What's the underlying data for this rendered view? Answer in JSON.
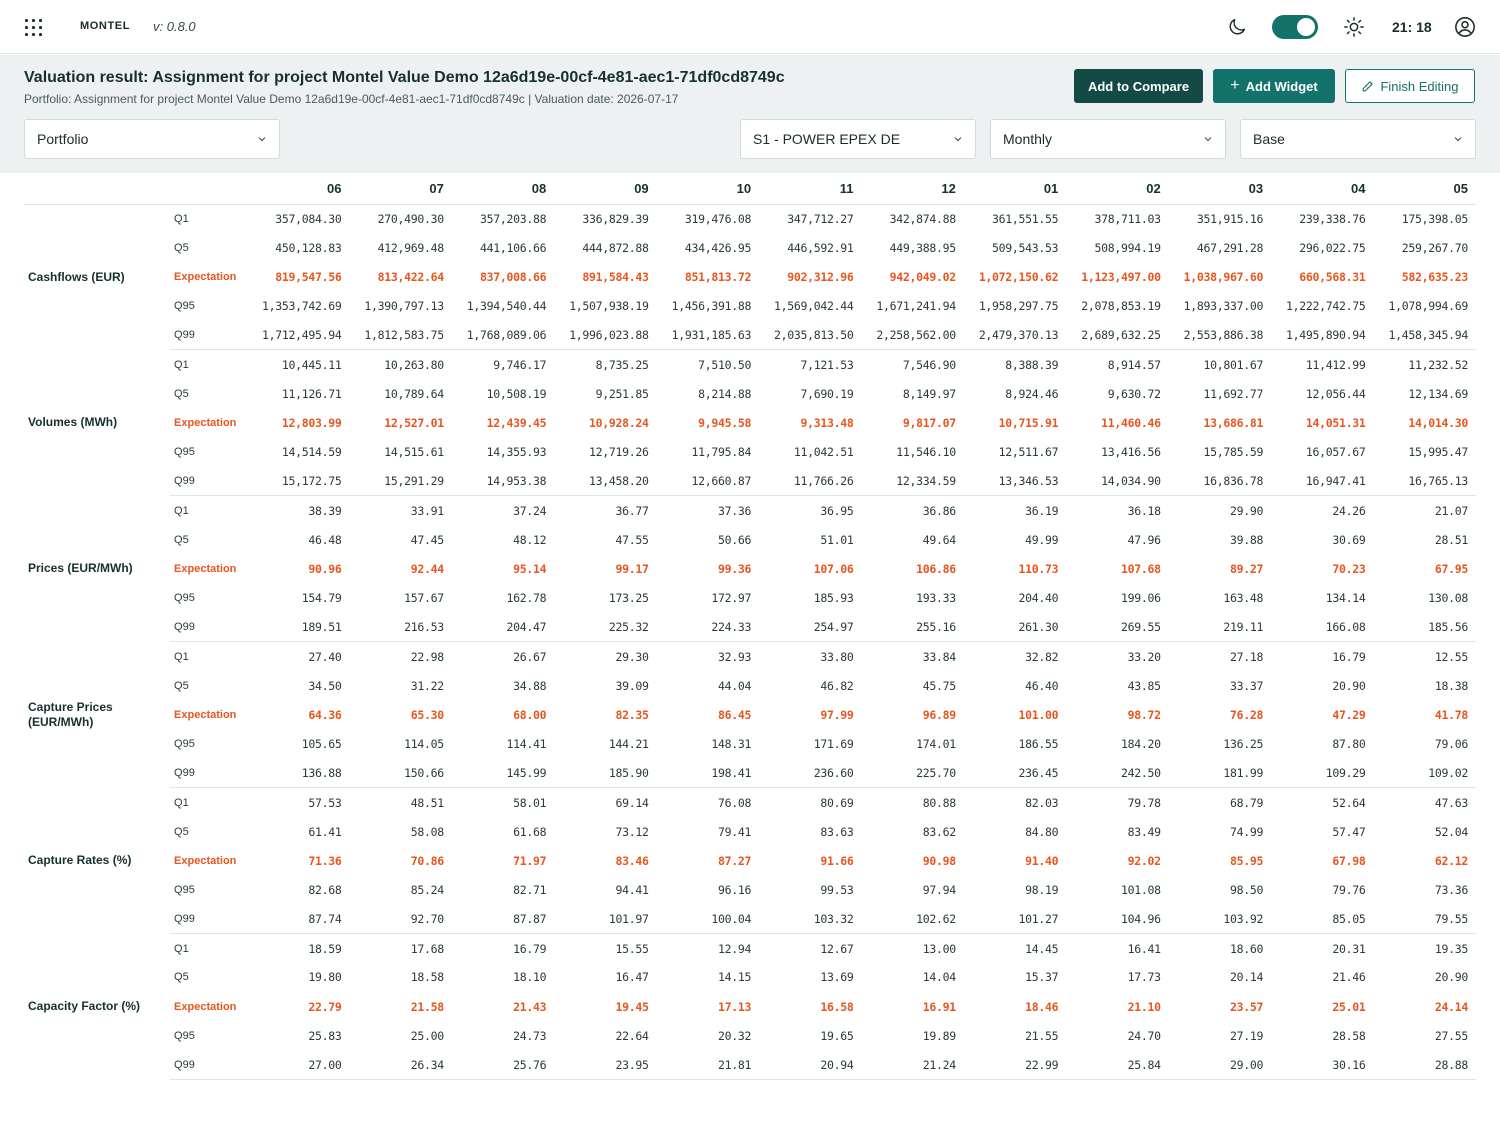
{
  "topbar": {
    "logo": "MONTEL",
    "version": "v: 0.8.0",
    "time": "21: 18"
  },
  "header": {
    "title": "Valuation result: Assignment for project Montel Value Demo 12a6d19e-00cf-4e81-aec1-71df0cd8749c",
    "subtitle": "Portfolio: Assignment for project Montel Value Demo 12a6d19e-00cf-4e81-aec1-71df0cd8749c | Valuation date: 2026-07-17",
    "buttons": {
      "compare": "Add to Compare",
      "widget": "Add Widget",
      "finish": "Finish Editing"
    },
    "selects": {
      "portfolio": "Portfolio",
      "series": "S1 - POWER EPEX DE",
      "frequency": "Monthly",
      "base": "Base"
    }
  },
  "colors": {
    "accent": "#13726a",
    "dark_accent": "#144a45",
    "expectation": "#e8561f"
  },
  "table": {
    "columns": [
      "06",
      "07",
      "08",
      "09",
      "10",
      "11",
      "12",
      "01",
      "02",
      "03",
      "04",
      "05"
    ],
    "groups": [
      {
        "metric": "Cashflows (EUR)",
        "rows": [
          {
            "stat": "Q1",
            "values": [
              "357,084.30",
              "270,490.30",
              "357,203.88",
              "336,829.39",
              "319,476.08",
              "347,712.27",
              "342,874.88",
              "361,551.55",
              "378,711.03",
              "351,915.16",
              "239,338.76",
              "175,398.05"
            ]
          },
          {
            "stat": "Q5",
            "values": [
              "450,128.83",
              "412,969.48",
              "441,106.66",
              "444,872.88",
              "434,426.95",
              "446,592.91",
              "449,388.95",
              "509,543.53",
              "508,994.19",
              "467,291.28",
              "296,022.75",
              "259,267.70"
            ]
          },
          {
            "stat": "Expectation",
            "values": [
              "819,547.56",
              "813,422.64",
              "837,008.66",
              "891,584.43",
              "851,813.72",
              "902,312.96",
              "942,049.02",
              "1,072,150.62",
              "1,123,497.00",
              "1,038,967.60",
              "660,568.31",
              "582,635.23"
            ]
          },
          {
            "stat": "Q95",
            "values": [
              "1,353,742.69",
              "1,390,797.13",
              "1,394,540.44",
              "1,507,938.19",
              "1,456,391.88",
              "1,569,042.44",
              "1,671,241.94",
              "1,958,297.75",
              "2,078,853.19",
              "1,893,337.00",
              "1,222,742.75",
              "1,078,994.69"
            ]
          },
          {
            "stat": "Q99",
            "values": [
              "1,712,495.94",
              "1,812,583.75",
              "1,768,089.06",
              "1,996,023.88",
              "1,931,185.63",
              "2,035,813.50",
              "2,258,562.00",
              "2,479,370.13",
              "2,689,632.25",
              "2,553,886.38",
              "1,495,890.94",
              "1,458,345.94"
            ]
          }
        ]
      },
      {
        "metric": "Volumes (MWh)",
        "rows": [
          {
            "stat": "Q1",
            "values": [
              "10,445.11",
              "10,263.80",
              "9,746.17",
              "8,735.25",
              "7,510.50",
              "7,121.53",
              "7,546.90",
              "8,388.39",
              "8,914.57",
              "10,801.67",
              "11,412.99",
              "11,232.52"
            ]
          },
          {
            "stat": "Q5",
            "values": [
              "11,126.71",
              "10,789.64",
              "10,508.19",
              "9,251.85",
              "8,214.88",
              "7,690.19",
              "8,149.97",
              "8,924.46",
              "9,630.72",
              "11,692.77",
              "12,056.44",
              "12,134.69"
            ]
          },
          {
            "stat": "Expectation",
            "values": [
              "12,803.99",
              "12,527.01",
              "12,439.45",
              "10,928.24",
              "9,945.58",
              "9,313.48",
              "9,817.07",
              "10,715.91",
              "11,460.46",
              "13,686.81",
              "14,051.31",
              "14,014.30"
            ]
          },
          {
            "stat": "Q95",
            "values": [
              "14,514.59",
              "14,515.61",
              "14,355.93",
              "12,719.26",
              "11,795.84",
              "11,042.51",
              "11,546.10",
              "12,511.67",
              "13,416.56",
              "15,785.59",
              "16,057.67",
              "15,995.47"
            ]
          },
          {
            "stat": "Q99",
            "values": [
              "15,172.75",
              "15,291.29",
              "14,953.38",
              "13,458.20",
              "12,660.87",
              "11,766.26",
              "12,334.59",
              "13,346.53",
              "14,034.90",
              "16,836.78",
              "16,947.41",
              "16,765.13"
            ]
          }
        ]
      },
      {
        "metric": "Prices (EUR/MWh)",
        "rows": [
          {
            "stat": "Q1",
            "values": [
              "38.39",
              "33.91",
              "37.24",
              "36.77",
              "37.36",
              "36.95",
              "36.86",
              "36.19",
              "36.18",
              "29.90",
              "24.26",
              "21.07"
            ]
          },
          {
            "stat": "Q5",
            "values": [
              "46.48",
              "47.45",
              "48.12",
              "47.55",
              "50.66",
              "51.01",
              "49.64",
              "49.99",
              "47.96",
              "39.88",
              "30.69",
              "28.51"
            ]
          },
          {
            "stat": "Expectation",
            "values": [
              "90.96",
              "92.44",
              "95.14",
              "99.17",
              "99.36",
              "107.06",
              "106.86",
              "110.73",
              "107.68",
              "89.27",
              "70.23",
              "67.95"
            ]
          },
          {
            "stat": "Q95",
            "values": [
              "154.79",
              "157.67",
              "162.78",
              "173.25",
              "172.97",
              "185.93",
              "193.33",
              "204.40",
              "199.06",
              "163.48",
              "134.14",
              "130.08"
            ]
          },
          {
            "stat": "Q99",
            "values": [
              "189.51",
              "216.53",
              "204.47",
              "225.32",
              "224.33",
              "254.97",
              "255.16",
              "261.30",
              "269.55",
              "219.11",
              "166.08",
              "185.56"
            ]
          }
        ]
      },
      {
        "metric": "Capture Prices (EUR/MWh)",
        "rows": [
          {
            "stat": "Q1",
            "values": [
              "27.40",
              "22.98",
              "26.67",
              "29.30",
              "32.93",
              "33.80",
              "33.84",
              "32.82",
              "33.20",
              "27.18",
              "16.79",
              "12.55"
            ]
          },
          {
            "stat": "Q5",
            "values": [
              "34.50",
              "31.22",
              "34.88",
              "39.09",
              "44.04",
              "46.82",
              "45.75",
              "46.40",
              "43.85",
              "33.37",
              "20.90",
              "18.38"
            ]
          },
          {
            "stat": "Expectation",
            "values": [
              "64.36",
              "65.30",
              "68.00",
              "82.35",
              "86.45",
              "97.99",
              "96.89",
              "101.00",
              "98.72",
              "76.28",
              "47.29",
              "41.78"
            ]
          },
          {
            "stat": "Q95",
            "values": [
              "105.65",
              "114.05",
              "114.41",
              "144.21",
              "148.31",
              "171.69",
              "174.01",
              "186.55",
              "184.20",
              "136.25",
              "87.80",
              "79.06"
            ]
          },
          {
            "stat": "Q99",
            "values": [
              "136.88",
              "150.66",
              "145.99",
              "185.90",
              "198.41",
              "236.60",
              "225.70",
              "236.45",
              "242.50",
              "181.99",
              "109.29",
              "109.02"
            ]
          }
        ]
      },
      {
        "metric": "Capture Rates (%)",
        "rows": [
          {
            "stat": "Q1",
            "values": [
              "57.53",
              "48.51",
              "58.01",
              "69.14",
              "76.08",
              "80.69",
              "80.88",
              "82.03",
              "79.78",
              "68.79",
              "52.64",
              "47.63"
            ]
          },
          {
            "stat": "Q5",
            "values": [
              "61.41",
              "58.08",
              "61.68",
              "73.12",
              "79.41",
              "83.63",
              "83.62",
              "84.80",
              "83.49",
              "74.99",
              "57.47",
              "52.04"
            ]
          },
          {
            "stat": "Expectation",
            "values": [
              "71.36",
              "70.86",
              "71.97",
              "83.46",
              "87.27",
              "91.66",
              "90.98",
              "91.40",
              "92.02",
              "85.95",
              "67.98",
              "62.12"
            ]
          },
          {
            "stat": "Q95",
            "values": [
              "82.68",
              "85.24",
              "82.71",
              "94.41",
              "96.16",
              "99.53",
              "97.94",
              "98.19",
              "101.08",
              "98.50",
              "79.76",
              "73.36"
            ]
          },
          {
            "stat": "Q99",
            "values": [
              "87.74",
              "92.70",
              "87.87",
              "101.97",
              "100.04",
              "103.32",
              "102.62",
              "101.27",
              "104.96",
              "103.92",
              "85.05",
              "79.55"
            ]
          }
        ]
      },
      {
        "metric": "Capacity Factor (%)",
        "rows": [
          {
            "stat": "Q1",
            "values": [
              "18.59",
              "17.68",
              "16.79",
              "15.55",
              "12.94",
              "12.67",
              "13.00",
              "14.45",
              "16.41",
              "18.60",
              "20.31",
              "19.35"
            ]
          },
          {
            "stat": "Q5",
            "values": [
              "19.80",
              "18.58",
              "18.10",
              "16.47",
              "14.15",
              "13.69",
              "14.04",
              "15.37",
              "17.73",
              "20.14",
              "21.46",
              "20.90"
            ]
          },
          {
            "stat": "Expectation",
            "values": [
              "22.79",
              "21.58",
              "21.43",
              "19.45",
              "17.13",
              "16.58",
              "16.91",
              "18.46",
              "21.10",
              "23.57",
              "25.01",
              "24.14"
            ]
          },
          {
            "stat": "Q95",
            "values": [
              "25.83",
              "25.00",
              "24.73",
              "22.64",
              "20.32",
              "19.65",
              "19.89",
              "21.55",
              "24.70",
              "27.19",
              "28.58",
              "27.55"
            ]
          },
          {
            "stat": "Q99",
            "values": [
              "27.00",
              "26.34",
              "25.76",
              "23.95",
              "21.81",
              "20.94",
              "21.24",
              "22.99",
              "25.84",
              "29.00",
              "30.16",
              "28.88"
            ]
          }
        ]
      }
    ]
  }
}
